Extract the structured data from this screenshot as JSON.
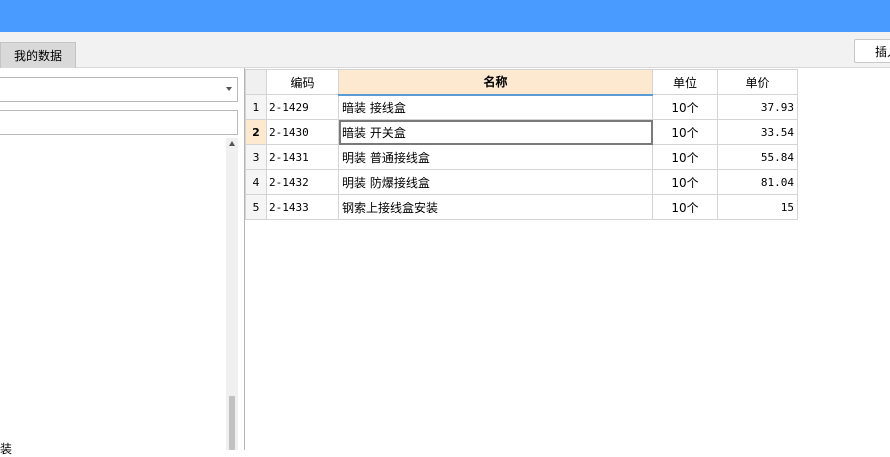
{
  "tabs": [
    {
      "label": "我的数据"
    }
  ],
  "toolbar": {
    "insert_label": "插入"
  },
  "left_panel": {
    "bottom_text": "装"
  },
  "grid": {
    "columns": [
      "编码",
      "名称",
      "单位",
      "单价"
    ],
    "rows": [
      {
        "num": "1",
        "code": "2-1429",
        "name": "暗装 接线盒",
        "unit": "10个",
        "price": "37.93"
      },
      {
        "num": "2",
        "code": "2-1430",
        "name": "暗装 开关盒",
        "unit": "10个",
        "price": "33.54"
      },
      {
        "num": "3",
        "code": "2-1431",
        "name": "明装 普通接线盒",
        "unit": "10个",
        "price": "55.84"
      },
      {
        "num": "4",
        "code": "2-1432",
        "name": "明装 防爆接线盒",
        "unit": "10个",
        "price": "81.04"
      },
      {
        "num": "5",
        "code": "2-1433",
        "name": "钢索上接线盒安装",
        "unit": "10个",
        "price": "15"
      }
    ]
  },
  "colors": {
    "titlebar": "#4a9bff",
    "header_highlight": "#fde9cf",
    "accent_line": "#5b9bd5"
  }
}
